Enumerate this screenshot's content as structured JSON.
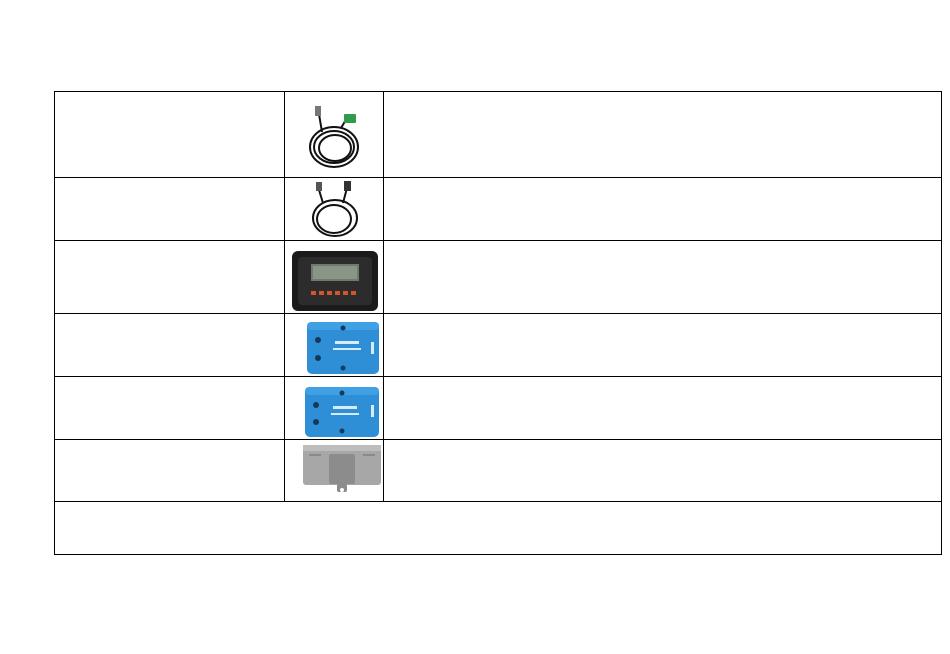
{
  "table": {
    "rows": [
      {
        "name": "",
        "image": "temperature-sensor-cable-photo",
        "description": ""
      },
      {
        "name": "",
        "image": "usb-communication-cable-photo",
        "description": ""
      },
      {
        "name": "",
        "image": "remote-meter-display-photo",
        "description": ""
      },
      {
        "name": "",
        "image": "blue-communication-adapter-photo",
        "description": ""
      },
      {
        "name": "",
        "image": "blue-communication-adapter-photo",
        "description": ""
      },
      {
        "name": "",
        "image": "grey-device-module-photo",
        "description": ""
      }
    ],
    "footer_note": ""
  },
  "colors": {
    "border": "#000000",
    "adapter_blue": "#2f8fd6",
    "meter_black": "#1b1b1b",
    "module_grey": "#9a9a9a"
  }
}
